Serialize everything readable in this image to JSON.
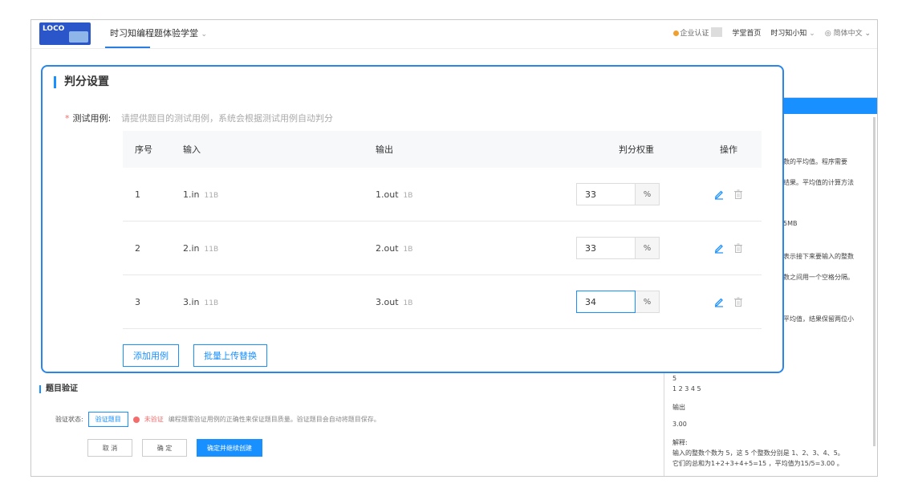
{
  "header": {
    "logo_text": "LOCO",
    "app_title": "时习知编程题体验学堂",
    "nav": {
      "cert_label": "企业认证",
      "home_label": "学堂首页",
      "user_label": "时习知小知",
      "lang_label": "简体中文"
    }
  },
  "modal": {
    "title": "判分设置",
    "field_label": "测试用例:",
    "field_hint": "请提供题目的测试用例，系统会根据测试用例自动判分",
    "columns": {
      "index": "序号",
      "input": "输入",
      "output": "输出",
      "weight": "判分权重",
      "actions": "操作"
    },
    "rows": [
      {
        "index": "1",
        "input": "1.in",
        "input_size": "11B",
        "output": "1.out",
        "output_size": "1B",
        "weight": "33",
        "unit": "%"
      },
      {
        "index": "2",
        "input": "2.in",
        "input_size": "11B",
        "output": "2.out",
        "output_size": "1B",
        "weight": "33",
        "unit": "%"
      },
      {
        "index": "3",
        "input": "3.in",
        "input_size": "11B",
        "output": "3.out",
        "output_size": "1B",
        "weight": "34",
        "unit": "%"
      }
    ],
    "add_button": "添加用例",
    "batch_button": "批量上传替换"
  },
  "right_panel": {
    "lines": [
      "数的平均值。程序需要",
      "结果。平均值的计算方法",
      "5MB",
      "表示接下来要输入的整数",
      "数之间用一个空格分隔。",
      "平均值，结果保留两位小"
    ],
    "sample_input_n": "5",
    "sample_input_vals": "1 2 3 4 5",
    "output_label": "输出",
    "output_value": "3.00",
    "explain_label": "解释:",
    "explain_line1": "输入的整数个数为 5，这 5 个整数分别是 1、2、3、4、5。",
    "explain_line2": "它们的总和为1+2+3+4+5=15 ，平均值为15/5=3.00 。"
  },
  "verify": {
    "section_title": "题目验证",
    "status_label": "验证状态:",
    "verify_button": "验证题目",
    "status_value": "未验证",
    "hint": "编程题需验证用例的正确性来保证题目质量。验证题目会自动将题目保存。",
    "cancel": "取 消",
    "confirm": "确 定",
    "confirm_continue": "确定并继续创建"
  },
  "colors": {
    "accent": "#1890ff",
    "warning": "#f56c6c",
    "modal_border": "#2a86e8"
  }
}
